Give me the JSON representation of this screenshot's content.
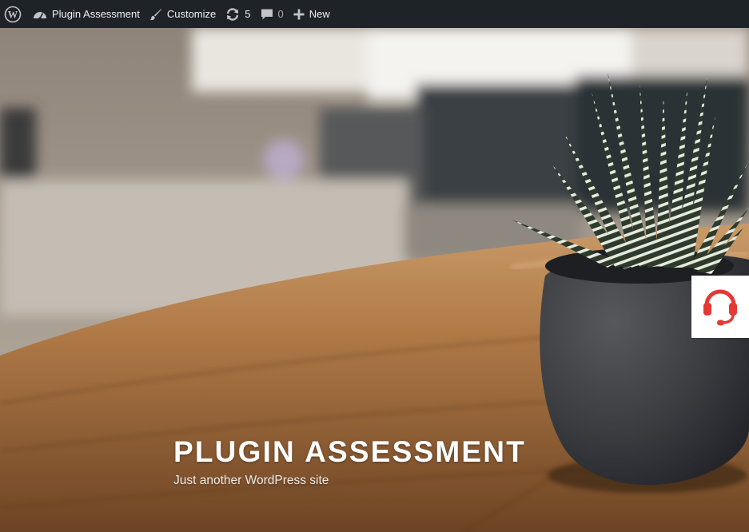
{
  "admin_bar": {
    "site_name": "Plugin Assessment",
    "customize_label": "Customize",
    "updates_count": "5",
    "comments_count": "0",
    "new_label": "New",
    "icons": [
      "wordpress-icon",
      "dashboard-icon",
      "brush-icon",
      "updates-icon",
      "comment-icon",
      "plus-icon"
    ],
    "colors": {
      "background": "#1d2327",
      "text": "#f0f0f1"
    }
  },
  "hero": {
    "title": "PLUGIN ASSESSMENT",
    "description": "Just another WordPress site"
  },
  "support_widget": {
    "icon": "headset-icon",
    "accent": "#e53935"
  }
}
